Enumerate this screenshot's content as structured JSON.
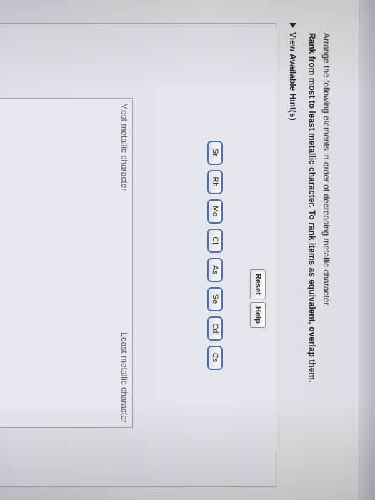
{
  "instructions": {
    "line1": "Arrange the following elements in order of decreasing metallic character.",
    "line2": "Rank from most to least metallic character. To rank items as equivalent, overlap them."
  },
  "hints": {
    "label": "View Available Hint(s)"
  },
  "controls": {
    "reset_label": "Reset",
    "help_label": "Help"
  },
  "tiles": [
    "Sr",
    "Rh",
    "Mo",
    "Cl",
    "As",
    "Se",
    "Cd",
    "Cs"
  ],
  "ranking": {
    "most_label": "Most metallic character",
    "least_label": "Least metallic character"
  },
  "colors": {
    "tile_border": "#4d6fb0",
    "background": "#e4e5ea"
  }
}
